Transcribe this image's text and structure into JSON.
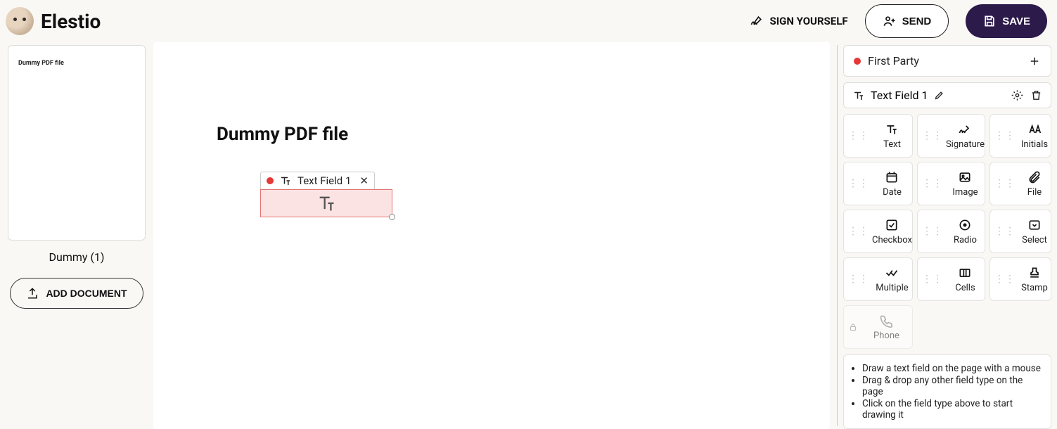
{
  "brand": "Elestio",
  "header": {
    "sign_yourself": "SIGN YOURSELF",
    "send": "SEND",
    "save": "SAVE"
  },
  "sidebar": {
    "thumb_text": "Dummy PDF file",
    "thumb_label": "Dummy (1)",
    "add_document": "ADD DOCUMENT"
  },
  "canvas": {
    "document_title": "Dummy PDF file",
    "field_label": "Text Field 1"
  },
  "right": {
    "party_name": "First Party",
    "field_name": "Text Field 1",
    "tools": {
      "text": "Text",
      "signature": "Signature",
      "initials": "Initials",
      "date": "Date",
      "image": "Image",
      "file": "File",
      "checkbox": "Checkbox",
      "radio": "Radio",
      "select": "Select",
      "multiple": "Multiple",
      "cells": "Cells",
      "stamp": "Stamp",
      "phone": "Phone"
    },
    "hints": [
      "Draw a text field on the page with a mouse",
      "Drag & drop any other field type on the page",
      "Click on the field type above to start drawing it"
    ]
  }
}
